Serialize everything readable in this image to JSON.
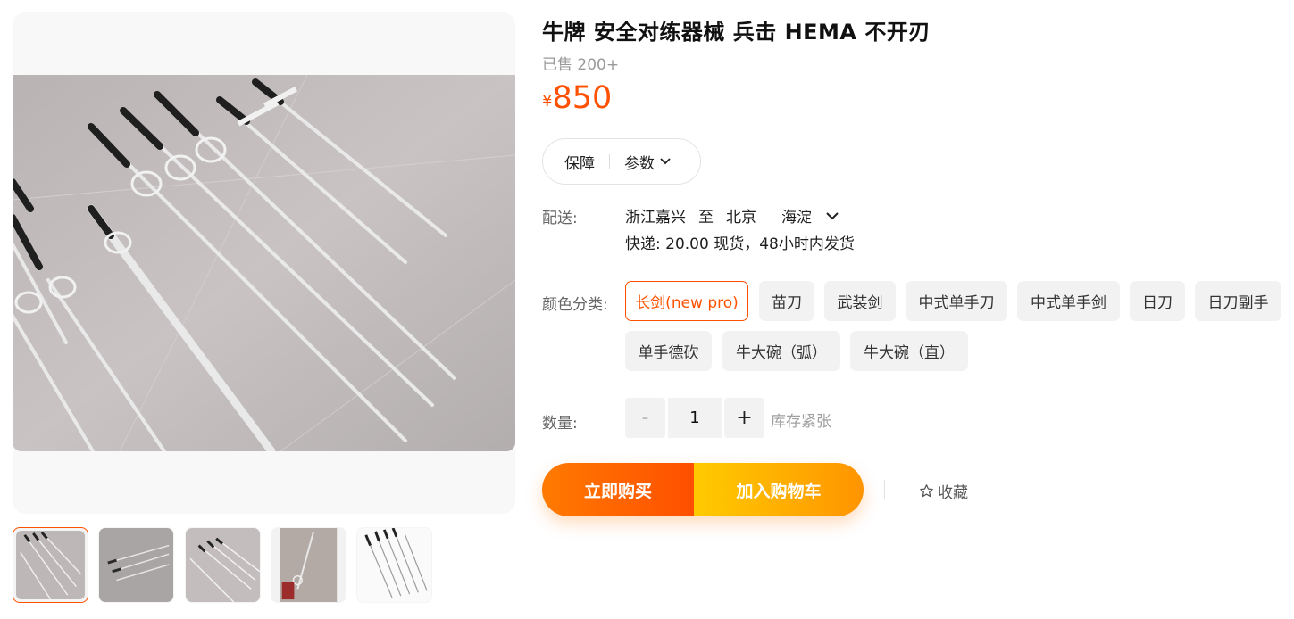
{
  "product": {
    "title": "牛牌 安全对练器械 兵击 HEMA 不开刃",
    "sold": "已售 200+",
    "price_symbol": "¥",
    "price": "850"
  },
  "service": {
    "guarantee": "保障",
    "params": "参数"
  },
  "delivery": {
    "label": "配送:",
    "from": "浙江嘉兴",
    "to_word": "至",
    "city": "北京",
    "district": "海淀",
    "shipping": "快递: 20.00  现货，48小时内发货"
  },
  "sku": {
    "label": "颜色分类:",
    "options": [
      "长剑(new pro)",
      "苗刀",
      "武装剑",
      "中式单手刀",
      "中式单手剑",
      "日刀",
      "日刀副手",
      "单手德砍",
      "牛大碗（弧）",
      "牛大碗（直）"
    ],
    "selected": "长剑(new pro)"
  },
  "quantity": {
    "label": "数量:",
    "minus": "-",
    "value": "1",
    "plus": "+",
    "stock": "库存紧张"
  },
  "actions": {
    "buy_now": "立即购买",
    "add_cart": "加入购物车",
    "favorite": "收藏"
  },
  "colors": {
    "accent": "#ff5000",
    "buy_gradient": [
      "#ff7a00",
      "#ff4f00"
    ],
    "cart_gradient": [
      "#ffcb00",
      "#ff9400"
    ]
  }
}
